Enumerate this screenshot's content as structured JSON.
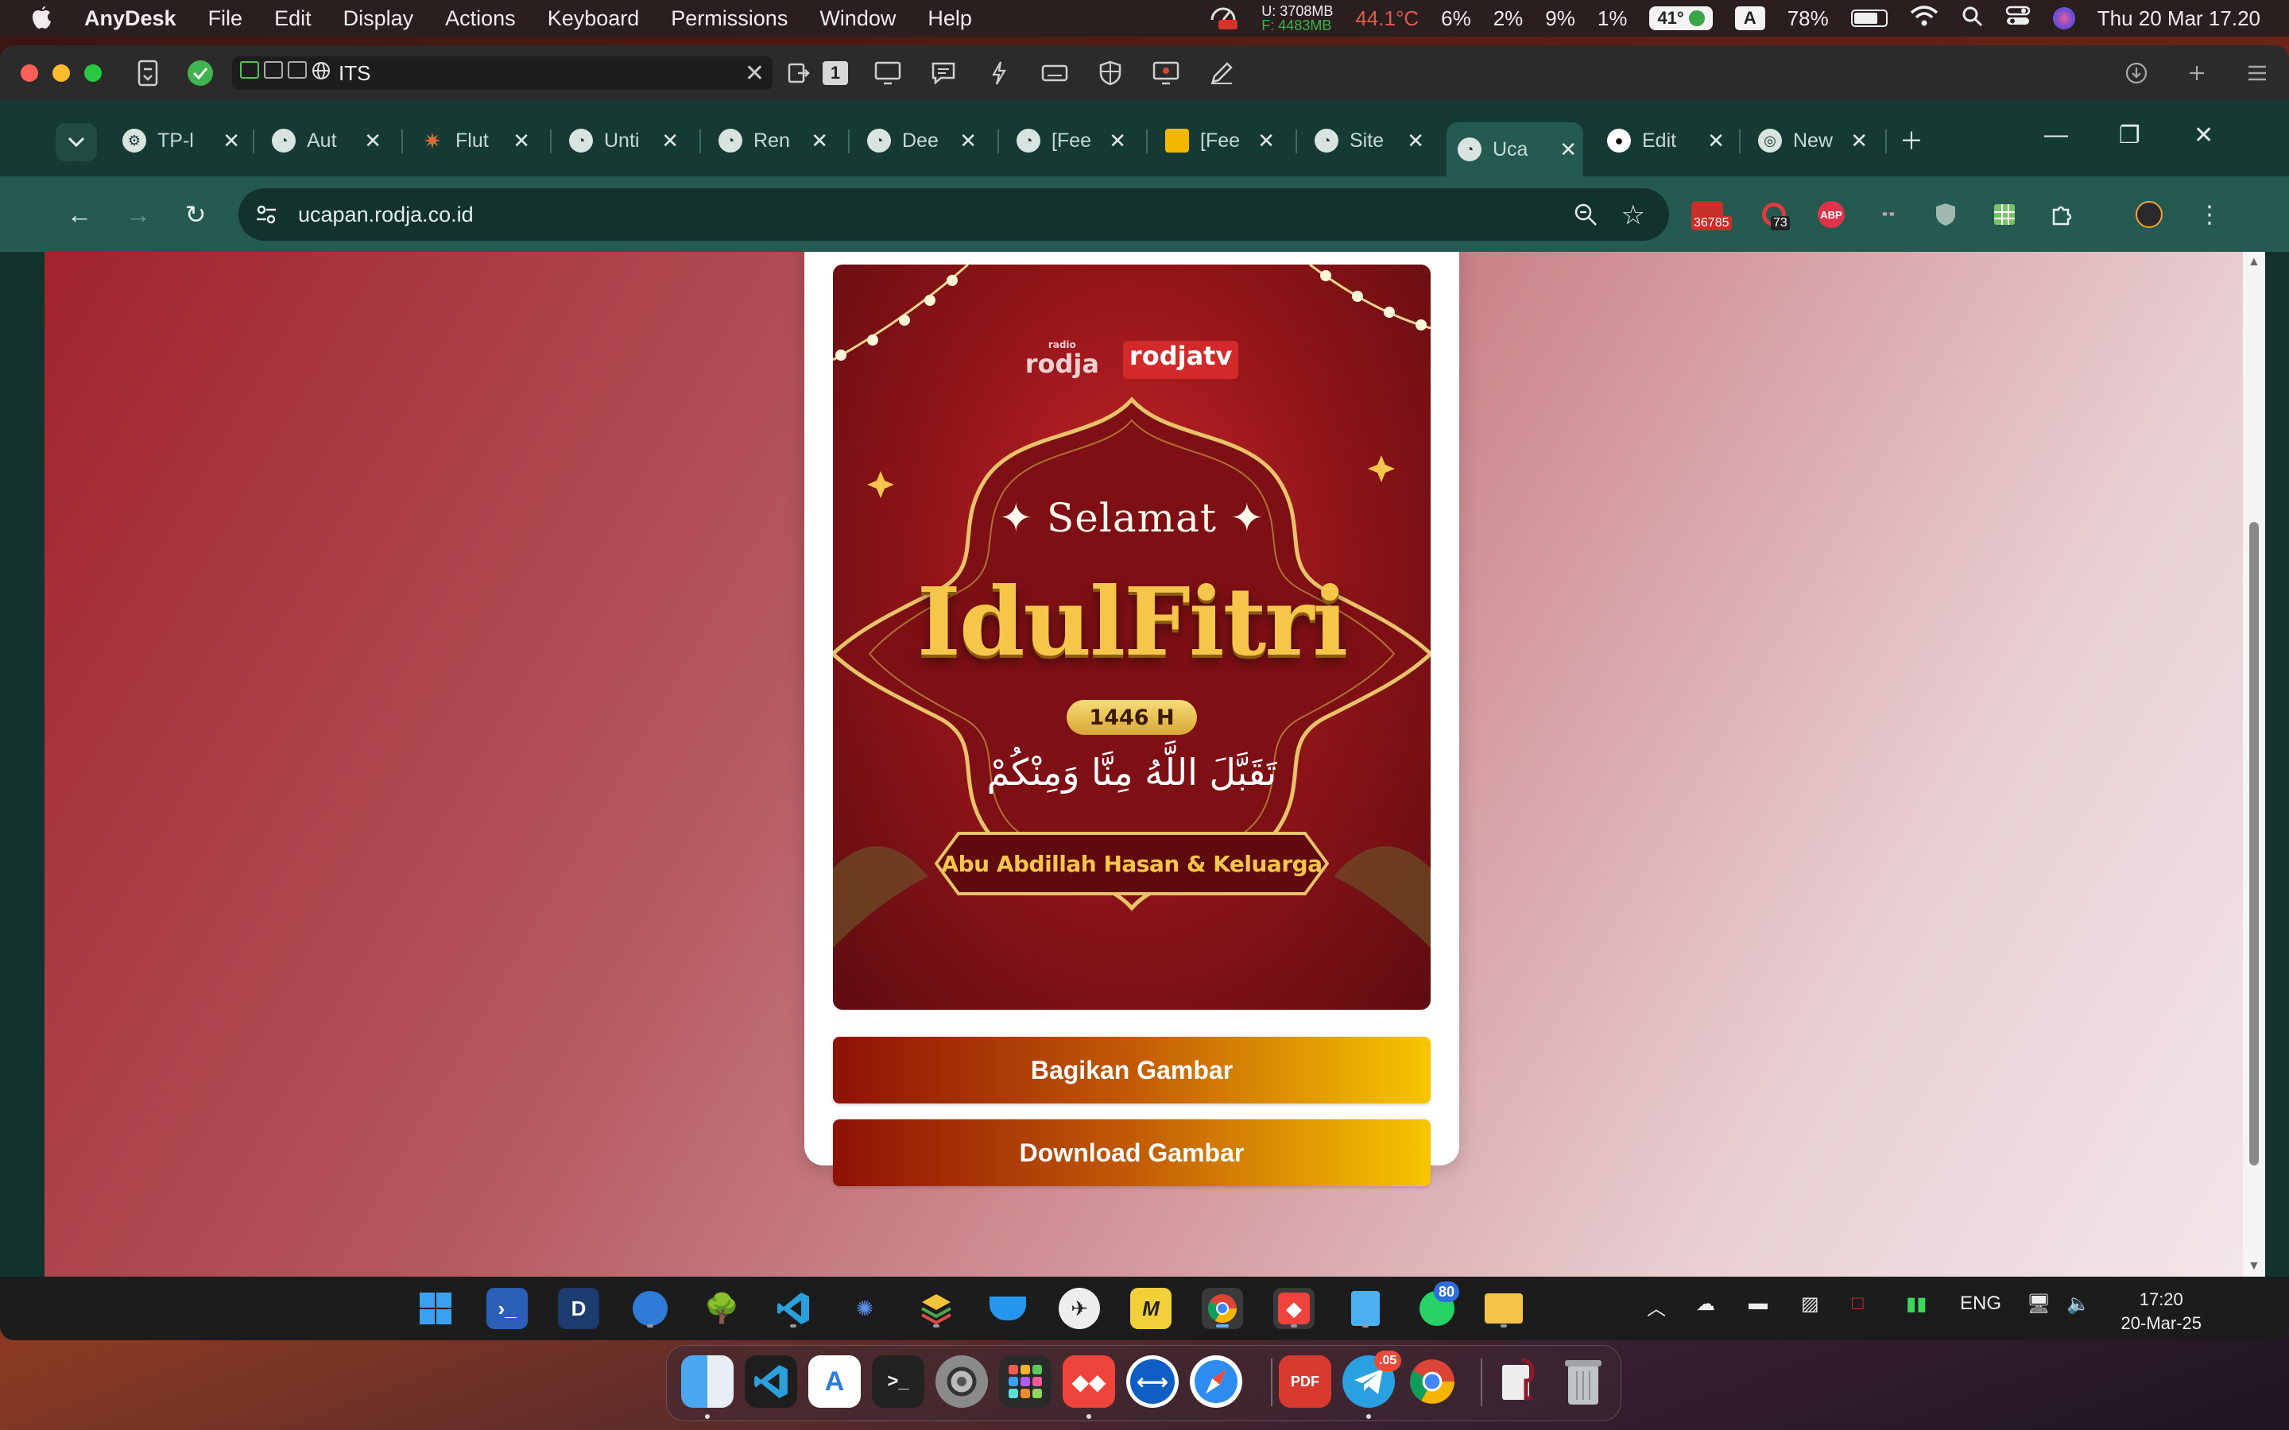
{
  "menubar": {
    "app_name": "AnyDesk",
    "menus": [
      "File",
      "Edit",
      "Display",
      "Actions",
      "Keyboard",
      "Permissions",
      "Window",
      "Help"
    ],
    "mem_used": "U: 3708MB",
    "mem_free": "F: 4483MB",
    "cpu_temp": "44.1°C",
    "stat1": "6%",
    "stat2": "2%",
    "stat3": "9%",
    "stat4": "1%",
    "temp_pill": "41°",
    "input_source": "A",
    "battery_level": "78%",
    "battery_fraction": 0.78,
    "datetime": "Thu 20 Mar  17.20"
  },
  "anydesk": {
    "session_name": "ITS",
    "monitor_number": "1"
  },
  "chrome": {
    "tabs": [
      "TP-l",
      "Aut",
      "Flut",
      "Unti",
      "Ren",
      "Dee",
      "[Fee",
      "[Fee",
      "Site",
      "Uca",
      "Edit",
      "New"
    ],
    "active_tab_index": 9,
    "url": "ucapan.rodja.co.id",
    "ext_badge_1": "36785",
    "ext_badge_2": "73",
    "ext_abp": "ABP"
  },
  "poster": {
    "logo_radio": "rodja",
    "logo_radio_small": "radio",
    "logo_tv": "rodjatv",
    "greeting": "Selamat",
    "title": "IdulFitri",
    "year": "1446 H",
    "arabic": "تَقَبَّلَ اللَّهُ مِنَّا وَمِنْكُمْ",
    "name": "Abu Abdillah Hasan & Keluarga"
  },
  "actions": {
    "share_label": "Bagikan Gambar",
    "download_label": "Download Gambar"
  },
  "taskbar": {
    "whatsapp_badge": "80",
    "lang": "ENG",
    "time": "17:20",
    "date": "20-Mar-25"
  },
  "dock": {
    "telegram_badge": ".05"
  },
  "colors": {
    "page_gradient_start": "#a1232d",
    "page_gradient_end": "#f3e6ea",
    "button_gradient_start": "#8e1106",
    "button_gradient_end": "#f7c600",
    "chrome_theme": "#245a50"
  }
}
